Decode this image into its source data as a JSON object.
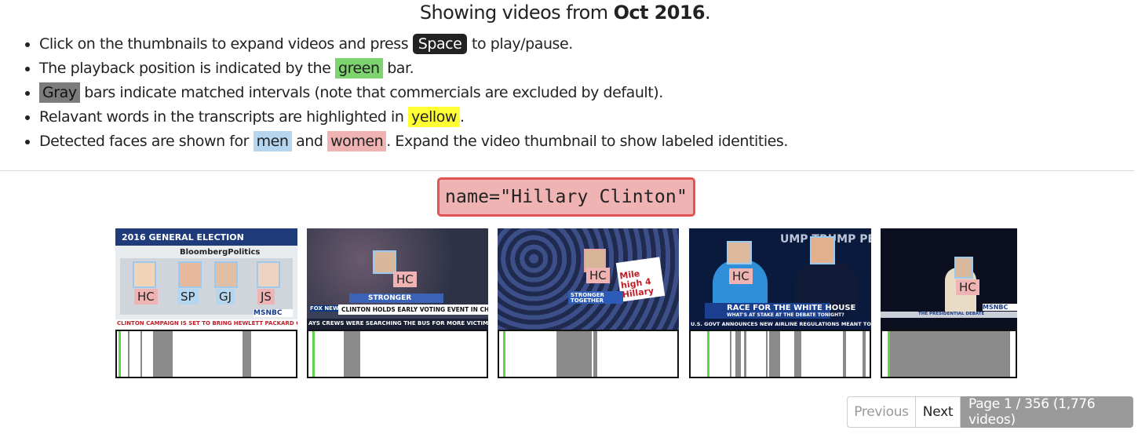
{
  "header": {
    "title_prefix": "Showing videos from ",
    "title_month": "Oct 2016",
    "title_suffix": "."
  },
  "instructions": {
    "i1_a": "Click on the thumbnails to expand videos and press ",
    "i1_key": "Space",
    "i1_b": " to play/pause.",
    "i2_a": "The playback position is indicated by the ",
    "i2_hl": "green",
    "i2_b": " bar.",
    "i3_hl": "Gray",
    "i3_b": " bars indicate matched intervals (note that commercials are excluded by default).",
    "i4_a": "Relavant words in the transcripts are highlighted in ",
    "i4_hl": "yellow",
    "i4_b": ".",
    "i5_a": "Detected faces are shown for ",
    "i5_men": "men",
    "i5_mid": " and ",
    "i5_women": "women",
    "i5_b": ". Expand the video thumbnail to show labeled identities."
  },
  "query": "name=\"Hillary Clinton\"",
  "colors": {
    "playback": "#62d24a",
    "matched": "#8a8a8a",
    "men": "#b6d5ee",
    "women": "#efb3b3",
    "transcript_highlight": "#ffff33"
  },
  "videos": [
    {
      "header_text": "2016 GENERAL ELECTION",
      "subheader_text": "BloombergPolitics",
      "face_labels": [
        "HC",
        "SP",
        "GJ",
        "JS"
      ],
      "network": "MSNBC",
      "ticker": "CLINTON CAMPAIGN IS SET TO BRING HEWLETT PACKARD CEO MEG WHITMA",
      "playback": 0.01,
      "matched": [
        [
          0.06,
          0.07
        ],
        [
          0.13,
          0.14
        ],
        [
          0.2,
          0.31
        ],
        [
          0.7,
          0.75
        ]
      ]
    },
    {
      "face_labels": [
        "HC"
      ],
      "banner_text": "STRONGER",
      "lower_third": "CLINTON HOLDS EARLY VOTING EVENT IN CHARLOTTE, NC",
      "alert": "FOX NEWS ALERT",
      "ticker": "AYS CREWS WERE SEARCHING THE BUS FOR MORE VICTIMS AFTER WRECK EARLY S",
      "playback": 0.02,
      "matched": [
        [
          0.2,
          0.29
        ]
      ]
    },
    {
      "face_labels": [
        "HC"
      ],
      "sign_text": "Mile high 4 Hillary",
      "banner_text": "STRONGER TOGETHER",
      "playback": 0.02,
      "matched": [
        [
          0.32,
          0.52
        ],
        [
          0.53,
          0.55
        ]
      ]
    },
    {
      "face_labels": [
        "HC"
      ],
      "lower_third": "RACE FOR THE WHITE HOUSE",
      "lower_sub": "WHAT'S AT STAKE AT THE DEBATE TONIGHT?",
      "ticker": "U.S. GOVT ANNOUNCES NEW AIRLINE REGULATIONS MEANT TO PROTECT CONSU",
      "backdrop_text": "UMP  TRUMP PENCE",
      "playback": 0.09,
      "matched": [
        [
          0.22,
          0.23
        ],
        [
          0.25,
          0.28
        ],
        [
          0.3,
          0.31
        ],
        [
          0.42,
          0.43
        ],
        [
          0.44,
          0.5
        ],
        [
          0.58,
          0.62
        ],
        [
          0.85,
          0.87
        ],
        [
          0.96,
          0.98
        ]
      ]
    },
    {
      "face_labels": [
        "HC"
      ],
      "network": "MSNBC",
      "lower_third": "THE PRESIDENTIAL DEBATE",
      "playback": 0.04,
      "matched": [
        [
          0.06,
          0.96
        ]
      ]
    }
  ],
  "pager": {
    "previous": "Previous",
    "next": "Next",
    "info": "Page 1 / 356 (1,776 videos)"
  }
}
